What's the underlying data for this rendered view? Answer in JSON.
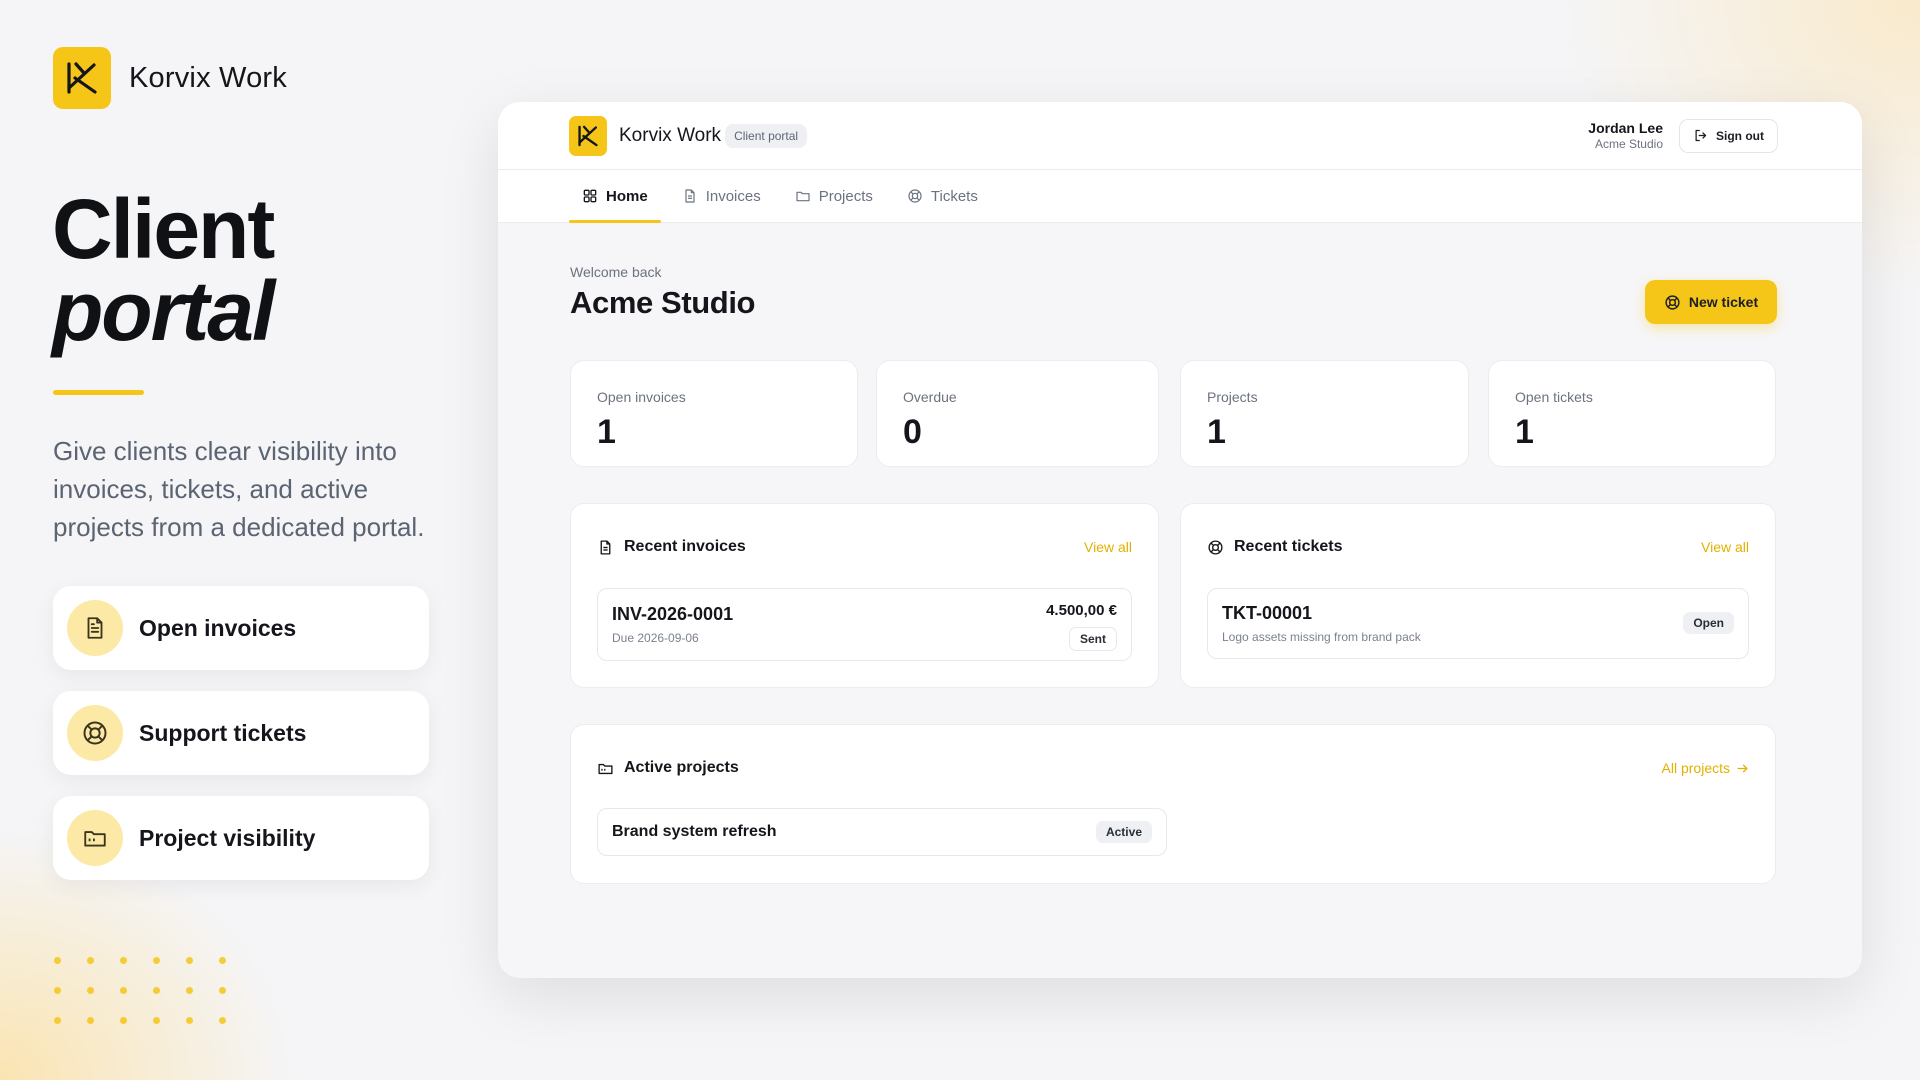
{
  "brand": {
    "name": "Korvix Work",
    "accent": "#f5c518"
  },
  "hero": {
    "title_line1": "Client",
    "title_line2": "portal",
    "description": "Give clients clear visibility into invoices, tickets, and active projects from a dedicated portal.",
    "features": [
      {
        "label": "Open invoices",
        "icon": "document-icon"
      },
      {
        "label": "Support tickets",
        "icon": "lifebuoy-icon"
      },
      {
        "label": "Project visibility",
        "icon": "folder-icon"
      }
    ]
  },
  "app": {
    "brand_name": "Korvix Work",
    "portal_pill": "Client portal",
    "user": {
      "name": "Jordan Lee",
      "org": "Acme Studio"
    },
    "sign_out_label": "Sign out",
    "tabs": [
      {
        "label": "Home",
        "icon": "grid-icon",
        "active": true
      },
      {
        "label": "Invoices",
        "icon": "document-icon",
        "active": false
      },
      {
        "label": "Projects",
        "icon": "folder-icon",
        "active": false
      },
      {
        "label": "Tickets",
        "icon": "lifebuoy-icon",
        "active": false
      }
    ],
    "welcome": "Welcome back",
    "org_title": "Acme Studio",
    "new_ticket_label": "New ticket",
    "stats": [
      {
        "label": "Open invoices",
        "value": "1"
      },
      {
        "label": "Overdue",
        "value": "0"
      },
      {
        "label": "Projects",
        "value": "1"
      },
      {
        "label": "Open tickets",
        "value": "1"
      }
    ],
    "recent_invoices": {
      "title": "Recent invoices",
      "link": "View all",
      "items": [
        {
          "id": "INV-2026-0001",
          "due": "Due 2026-09-06",
          "amount": "4.500,00 €",
          "status": "Sent"
        }
      ]
    },
    "recent_tickets": {
      "title": "Recent tickets",
      "link": "View all",
      "items": [
        {
          "id": "TKT-00001",
          "subject": "Logo assets missing from brand pack",
          "status": "Open"
        }
      ]
    },
    "active_projects": {
      "title": "Active projects",
      "link": "All projects",
      "items": [
        {
          "name": "Brand system refresh",
          "status": "Active"
        }
      ]
    }
  }
}
